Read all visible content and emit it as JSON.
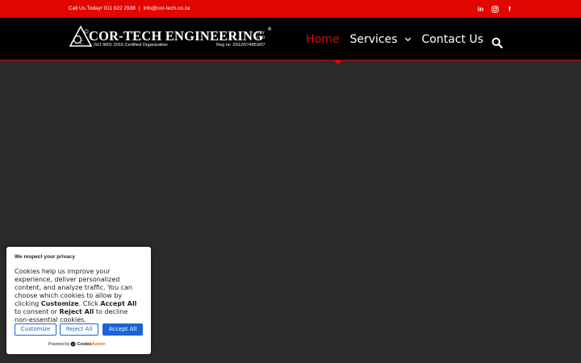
{
  "topbar": {
    "call": "Call Us Today! 011 822 2938",
    "separator": "|",
    "email": "info@cor-tech.co.za",
    "social": [
      {
        "icon": "linkedin-icon",
        "label": "in"
      },
      {
        "icon": "instagram-icon",
        "label": ""
      },
      {
        "icon": "facebook-icon",
        "label": "f"
      }
    ]
  },
  "logo": {
    "brand": "COR-TECH ENGINEERING",
    "pty": "PTY",
    "ltd": "LTD",
    "registered": "®",
    "iso": "ISO 9001:2015 Certified Organization",
    "reg_no": "Reg no :2012/074853/07"
  },
  "nav": {
    "items": [
      {
        "label": "Home",
        "active": true
      },
      {
        "label": "Services",
        "dropdown": true
      },
      {
        "label": "Contact Us"
      }
    ],
    "search_icon": "search-icon"
  },
  "cookie": {
    "title": "We respect your privacy",
    "body_1": "Cookies help us improve your experience, deliver personalized content, and analyze traffic. You can choose which cookies to allow by clicking ",
    "customize_bold": "Customize",
    "body_2": ". Click ",
    "accept_bold": "Accept All",
    "body_3": " to consent or ",
    "reject_bold": "Reject All",
    "body_4": " to decline non-essential cookies.",
    "customize_label": "Customize",
    "reject_label": "Reject All",
    "accept_label": "Accept All",
    "powered_by": "Powered by",
    "powered_brand_1": "Cookie",
    "powered_brand_2": "Admin"
  },
  "colors": {
    "accent_red": "#e10600",
    "header_black": "#000000",
    "page_bg": "#2a2a2a",
    "button_blue": "#1a63d6"
  }
}
